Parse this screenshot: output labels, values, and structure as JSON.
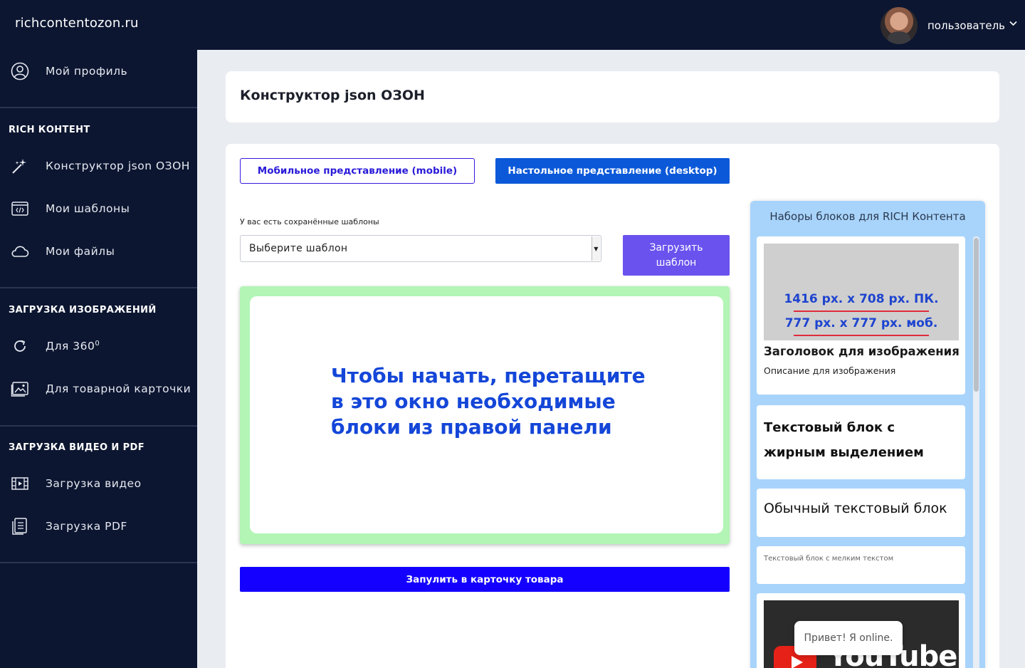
{
  "header": {
    "brand": "richcontentozon.ru",
    "user_name": "пользователь"
  },
  "sidebar": {
    "profile_label": "Мой профиль",
    "section_rich": "RICH КОНТЕНТ",
    "rich_items": [
      "Конструктор json ОЗОН",
      "Мои шаблоны",
      "Мои файлы"
    ],
    "section_images": "ЗАГРУЗКА ИЗОБРАЖЕНИЙ",
    "image_items": {
      "item360": "Для 360",
      "item360_sup": "0",
      "card": "Для товарной карточки"
    },
    "section_video": "ЗАГРУЗКА ВИДЕО И PDF",
    "video_items": [
      "Загрузка видео",
      "Загрузка PDF"
    ]
  },
  "main": {
    "title": "Конструктор json ОЗОН",
    "btn_mobile": "Мобильное представление (mobile)",
    "btn_desktop": "Настольное представление (desktop)",
    "templates_label": "У вас есть сохранённые шаблоны",
    "templates_select_value": "Выберите шаблон",
    "btn_load_line1": "Загрузить",
    "btn_load_line2": "шаблон",
    "drop_text": "Чтобы начать, перетащите в это окно необходимые блоки из правой панели",
    "btn_submit": "Запулить в карточку товара"
  },
  "blocks_panel": {
    "title": "Наборы блоков для RICH Контента",
    "block1": {
      "dim1": "1416 px. x 708 px. ПК.",
      "dim2": "777 px. x 777 px. моб.",
      "heading": "Заголовок для изображения",
      "desc": "Описание для изображения"
    },
    "block2": "Текстовый блок с жирным выделением",
    "block3": "Обычный текстовый блок",
    "block4": "Текстовый блок с мелким текстом",
    "block5_logo": "YouTube"
  },
  "chat": {
    "text": "Привет! Я online."
  }
}
